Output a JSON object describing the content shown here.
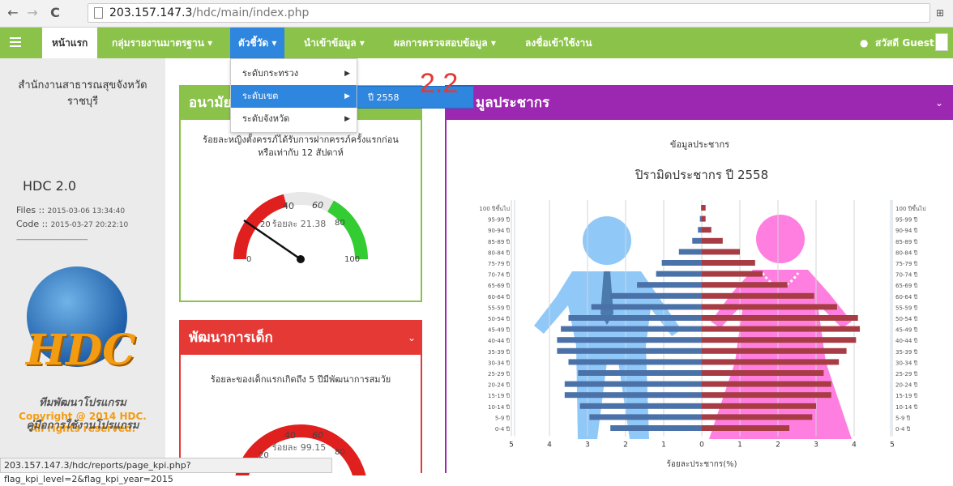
{
  "browser": {
    "url_host": "203.157.147.3",
    "url_path": "/hdc/main/index.php",
    "status_url": "203.157.147.3/hdc/reports/page_kpi.php?flag_kpi_level=2&flag_kpi_year=2015"
  },
  "navbar": {
    "items": [
      {
        "label": "หน้าแรก"
      },
      {
        "label": "กลุ่มรายงานมาตรฐาน ▾"
      },
      {
        "label": "ตัวชี้วัด ▾"
      },
      {
        "label": "นำเข้าข้อมูล ▾"
      },
      {
        "label": "ผลการตรวจสอบข้อมูล ▾"
      },
      {
        "label": "ลงชื่อเข้าใช้งาน"
      }
    ],
    "greeting": "สวัสดี Guest"
  },
  "dropdown": {
    "items": [
      {
        "label": "ระดับกระทรวง"
      },
      {
        "label": "ระดับเขต"
      },
      {
        "label": "ระดับจังหวัด"
      }
    ],
    "submenu": "ปี 2558",
    "annotation": "2.2"
  },
  "sidebar": {
    "org_line1": "สำนักงานสาธารณสุขจังหวัด",
    "org_line2": "ราชบุรี",
    "version": "HDC 2.0",
    "files_label": "Files ::",
    "files_date": "2015-03-06 13:34:40",
    "code_label": "Code ::",
    "code_date": "2015-03-27 20:22:10",
    "logo_text": "HDC",
    "copyright1": "Copyright @ 2014 HDC.",
    "copyright2": "All rights reserved.",
    "link1": "ทีมพัฒนาโปรแกรม",
    "link2": "คู่มือการใช้งานโปรแกรม"
  },
  "panels": {
    "anamai": {
      "title": "อนามัย",
      "desc1": "ร้อยละหญิงตั้งครรภ์ได้รับการฝากครรภ์ครั้งแรกก่อน",
      "desc2": "หรือเท่ากับ 12 สัปดาห์",
      "gauge_label": "ร้อยละ 21.38",
      "value": 21.38
    },
    "child": {
      "title": "พัฒนาการเด็ก",
      "desc": "ร้อยละของเด็กแรกเกิดถึง 5 ปีมีพัฒนาการสมวัย",
      "gauge_label": "ร้อยละ 99.15",
      "value": 99.15
    },
    "population": {
      "title": "มูลประชากร",
      "chart_header": "ข้อมูลประชากร"
    }
  },
  "gauge_ticks": [
    "0",
    "20",
    "40",
    "60",
    "80",
    "100"
  ],
  "colors": {
    "navbar": "#8bc34a",
    "active": "#2e86de",
    "anamai": "#8bc34a",
    "child": "#e53935",
    "population": "#9c27b0",
    "male_bar": "#4a72a8",
    "female_bar": "#a83c44"
  },
  "chart_data": {
    "type": "bar",
    "title": "ปิรามิดประชากร ปี 2558",
    "xlabel": "ร้อยละประชากร(%)",
    "xlim": [
      -5,
      5
    ],
    "x_ticks": [
      "5",
      "4",
      "3",
      "2",
      "1",
      "0",
      "1",
      "2",
      "3",
      "4",
      "5"
    ],
    "categories": [
      "100 ปีขึ้นไป",
      "95-99 ปี",
      "90-94 ปี",
      "85-89 ปี",
      "80-84 ปี",
      "75-79 ปี",
      "70-74 ปี",
      "65-69 ปี",
      "60-64 ปี",
      "55-59 ปี",
      "50-54 ปี",
      "45-49 ปี",
      "40-44 ปี",
      "35-39 ปี",
      "30-34 ปี",
      "25-29 ปี",
      "20-24 ปี",
      "15-19 ปี",
      "10-14 ปี",
      "5-9 ปี",
      "0-4 ปี"
    ],
    "series": [
      {
        "values": [
          0.02,
          0.05,
          0.1,
          0.25,
          0.6,
          1.05,
          1.2,
          1.7,
          2.4,
          2.9,
          3.5,
          3.7,
          3.8,
          3.8,
          3.5,
          3.25,
          3.6,
          3.6,
          3.2,
          2.95,
          2.4
        ]
      },
      {
        "values": [
          0.1,
          0.1,
          0.25,
          0.55,
          1.0,
          1.4,
          1.6,
          2.25,
          2.95,
          3.55,
          4.1,
          4.15,
          4.05,
          3.8,
          3.6,
          3.2,
          3.4,
          3.4,
          3.0,
          2.9,
          2.3
        ]
      }
    ]
  }
}
